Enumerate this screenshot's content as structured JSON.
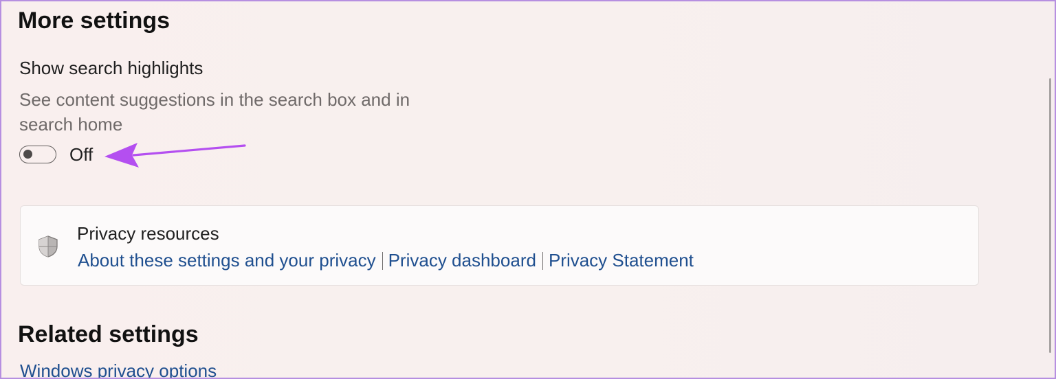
{
  "more_settings": {
    "heading": "More settings",
    "setting": {
      "title": "Show search highlights",
      "description": "See content suggestions in the search box and in search home",
      "toggle_state": "Off",
      "toggle_on": false
    }
  },
  "privacy_card": {
    "icon": "shield-icon",
    "title": "Privacy resources",
    "links": [
      "About these settings and your privacy",
      "Privacy dashboard",
      "Privacy Statement"
    ]
  },
  "related_settings": {
    "heading": "Related settings",
    "links": [
      "Windows privacy options"
    ]
  },
  "colors": {
    "accent_link": "#1f4f8f",
    "annotation_arrow": "#b44ff0",
    "frame_border": "#b68fe0"
  }
}
